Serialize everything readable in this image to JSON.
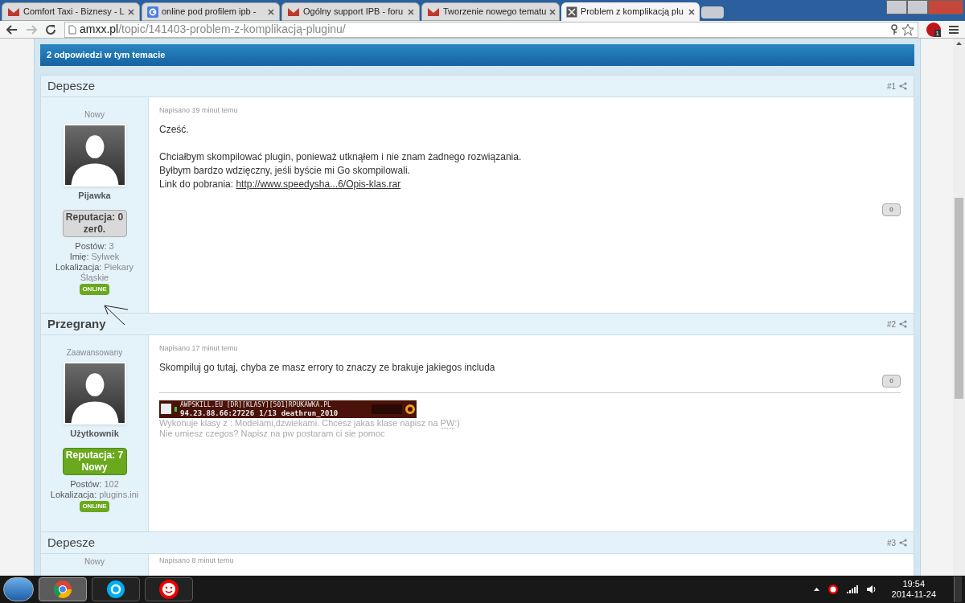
{
  "browser": {
    "tabs": [
      {
        "title": "Comfort Taxi - Biznesy - L",
        "kind": "mail",
        "selected": false
      },
      {
        "title": "online pod profilem ipb -",
        "kind": "google",
        "selected": false
      },
      {
        "title": "Ogólny support IPB - foru",
        "kind": "mail",
        "selected": false
      },
      {
        "title": "Tworzenie nowego tematu",
        "kind": "mail",
        "selected": false
      },
      {
        "title": "Problem z komplikacją plu",
        "kind": "page",
        "selected": true
      }
    ],
    "address": {
      "domain": "amxx.pl",
      "path": "/topic/141403-problem-z-komplikacją-pluginu/"
    },
    "extension_badge": "1"
  },
  "topic": {
    "header": "2 odpowiedzi w tym temacie",
    "posts": [
      {
        "author": "Depesze",
        "author_bold": false,
        "number": "#1",
        "rank": "Nowy",
        "username": "Pijawka",
        "reputation": {
          "kind": "neutral",
          "line1": "Reputacja: 0",
          "line2": "zer0."
        },
        "fields": [
          {
            "label": "Postów:",
            "value": "3"
          },
          {
            "label": "Imię:",
            "value": "Sylwek"
          },
          {
            "label": "Lokalizacja:",
            "value": "Piekary Śląskie"
          }
        ],
        "online": true,
        "online_label": "ONLINE",
        "annotated": true,
        "meta": "Napisano 19 minut temu",
        "body": [
          {
            "text": "Cześć."
          },
          {
            "text": "Chciałbym skompilować plugin, ponieważ utknąłem i nie znam żadnego rozwiązania.",
            "gap": true
          },
          {
            "text": "Byłbym bardzo wdzięczny, jeśli byście mi Go skompilowali."
          },
          {
            "text": "Link do pobrania: ",
            "link": "http://www.speedysha...6/Opis-klas.rar"
          }
        ],
        "like_count": "0"
      },
      {
        "author": "Przegrany",
        "author_bold": true,
        "number": "#2",
        "rank": "Zaawansowany",
        "username": "Użytkownik",
        "reputation": {
          "kind": "positive",
          "line1": "Reputacja: 7",
          "line2": "Nowy"
        },
        "fields": [
          {
            "label": "Postów:",
            "value": "102"
          },
          {
            "label": "Lokalizacja:",
            "value": "plugins.ini"
          }
        ],
        "online": true,
        "online_label": "ONLINE",
        "meta": "Napisano 17 minut temu",
        "body": [
          {
            "text": "Skompiluj go tutaj, chyba ze masz errory to znaczy ze brakuje jakiegos includa"
          }
        ],
        "like_count": "0",
        "signature": {
          "banner": {
            "line1": "AWPSKILL.EU [DR][KLASY][501]RPUKAWKA.PL",
            "address": "94.23.88.66:27226",
            "players": "1/13",
            "map": "deathrun_2010"
          },
          "lines": [
            {
              "before": "Wykonuje klasy z : Modelami,dzwiekami. Chcesz jakas klase napisz na ",
              "abbr": "PW",
              "after": ":)"
            },
            {
              "before": "Nie umiesz czegos? Napisz na pw postaram ci sie pomoc"
            }
          ]
        }
      },
      {
        "author": "Depesze",
        "author_bold": false,
        "number": "#3",
        "rank": "Nowy",
        "meta": "Napisano 8 minut temu"
      }
    ]
  },
  "taskbar": {
    "apps": [
      {
        "kind": "chrome",
        "selected": true
      },
      {
        "kind": "skype",
        "selected": false
      },
      {
        "kind": "smiley",
        "selected": false
      }
    ],
    "time": "19:54",
    "date": "2014-11-24"
  }
}
